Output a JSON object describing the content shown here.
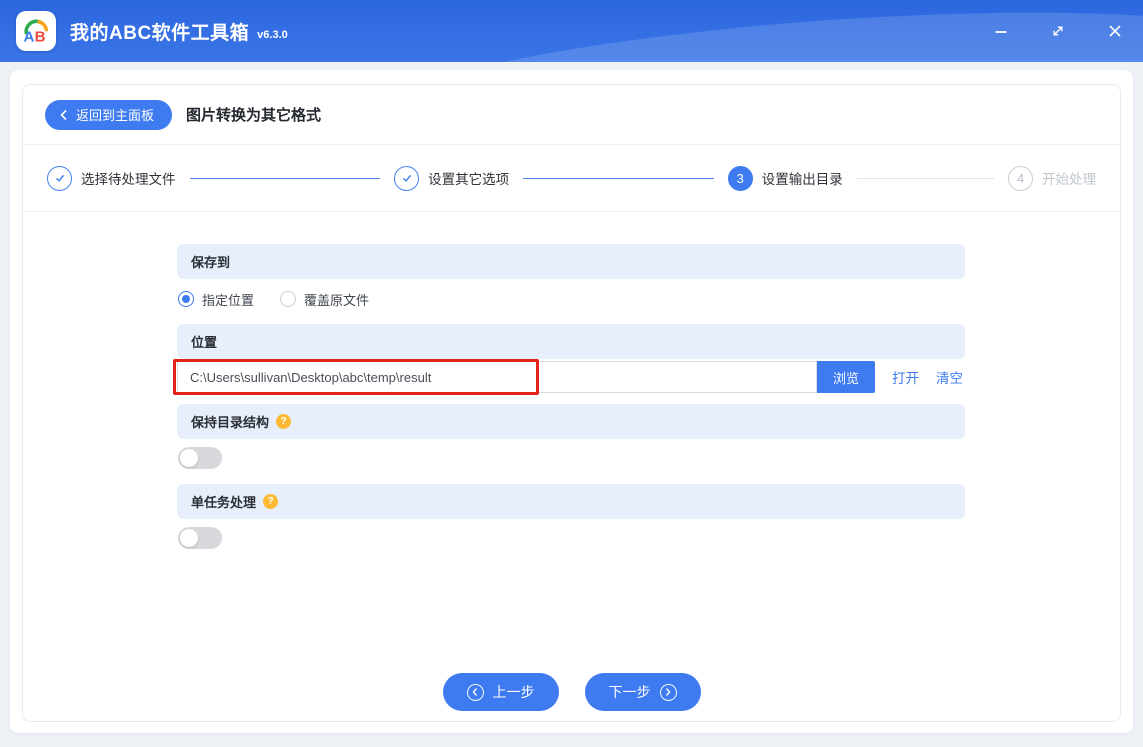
{
  "window": {
    "title": "我的ABC软件工具箱",
    "version": "v6.3.0"
  },
  "header": {
    "back_label": "返回到主面板",
    "page_title": "图片转换为其它格式"
  },
  "steps": {
    "items": [
      {
        "label": "选择待处理文件",
        "state": "done"
      },
      {
        "label": "设置其它选项",
        "state": "done"
      },
      {
        "label": "设置输出目录",
        "number": "3",
        "state": "active"
      },
      {
        "label": "开始处理",
        "number": "4",
        "state": "pending"
      }
    ]
  },
  "form": {
    "save_to": {
      "title": "保存到",
      "option_specified": "指定位置",
      "option_overwrite": "覆盖原文件",
      "selected_option": "指定位置"
    },
    "location": {
      "title": "位置",
      "path_value": "C:\\Users\\sullivan\\Desktop\\abc\\temp\\result",
      "browse_label": "浏览",
      "open_label": "打开",
      "clear_label": "清空"
    },
    "keep_structure": {
      "title": "保持目录结构",
      "enabled": false
    },
    "single_task": {
      "title": "单任务处理",
      "enabled": false
    }
  },
  "footer": {
    "prev_label": "上一步",
    "next_label": "下一步"
  },
  "colors": {
    "primary": "#3e7bf0",
    "titlebar_blue": "#3570e4",
    "section_bg": "#e7effc",
    "annotation_red": "#e2231a",
    "help_orange": "#fdb834",
    "toggle_off": "#d6d8db"
  }
}
